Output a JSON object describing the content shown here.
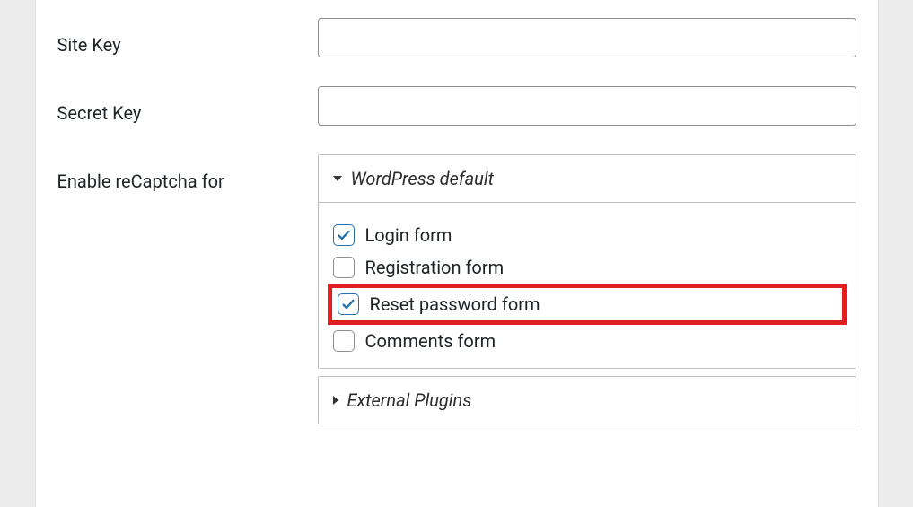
{
  "fields": {
    "site_key": {
      "label": "Site Key",
      "value": ""
    },
    "secret_key": {
      "label": "Secret Key",
      "value": ""
    },
    "enable_for": {
      "label": "Enable reCaptcha for"
    }
  },
  "sections": {
    "wp_default": {
      "title": "WordPress default",
      "expanded": true,
      "options": [
        {
          "label": "Login form",
          "checked": true,
          "highlight": false
        },
        {
          "label": "Registration form",
          "checked": false,
          "highlight": false
        },
        {
          "label": "Reset password form",
          "checked": true,
          "highlight": true
        },
        {
          "label": "Comments form",
          "checked": false,
          "highlight": false
        }
      ]
    },
    "external": {
      "title": "External Plugins",
      "expanded": false
    }
  }
}
